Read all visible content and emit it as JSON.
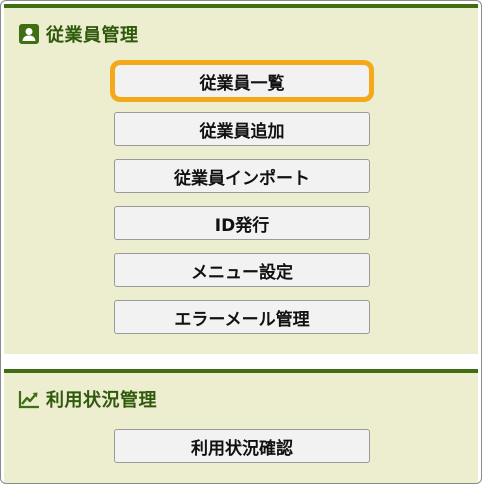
{
  "sections": [
    {
      "title": "従業員管理",
      "icon": "person-icon",
      "buttons": [
        {
          "label": "従業員一覧",
          "focused": true
        },
        {
          "label": "従業員追加"
        },
        {
          "label": "従業員インポート"
        },
        {
          "label": "ID発行"
        },
        {
          "label": "メニュー設定"
        },
        {
          "label": "エラーメール管理"
        }
      ]
    },
    {
      "title": "利用状況管理",
      "icon": "trend-chart-icon",
      "buttons": [
        {
          "label": "利用状況確認"
        }
      ]
    }
  ],
  "colors": {
    "accent_green": "#3f6e13",
    "panel_bg": "#ededcf",
    "focus_ring": "#f4a91b"
  }
}
